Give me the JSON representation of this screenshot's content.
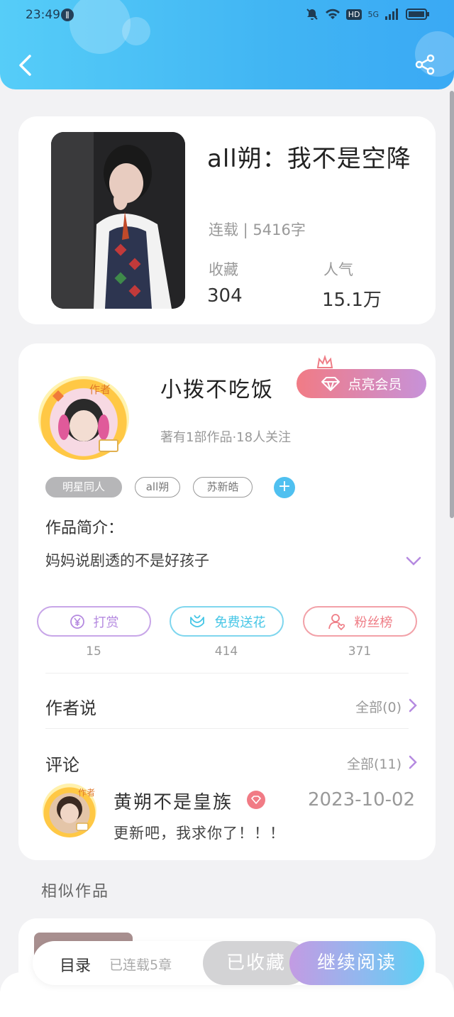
{
  "status_bar": {
    "time": "23:49",
    "notif_icon": "notification-badge-icon",
    "hd": "HD",
    "network": "5G"
  },
  "header": {
    "back_icon": "back-arrow-icon",
    "share_icon": "share-icon"
  },
  "book": {
    "title": "all朔：我不是空降",
    "status": "连载 | 5416字",
    "favorites_label": "收藏",
    "favorites_value": "304",
    "popularity_label": "人气",
    "popularity_value": "15.1万"
  },
  "author": {
    "avatar_tag": "作者",
    "name": "小拨不吃饭",
    "vip_button": "点亮会员",
    "meta": "著有1部作品·18人关注"
  },
  "tags": [
    "明星同人",
    "all朔",
    "苏新皓"
  ],
  "intro": {
    "label": "作品简介：",
    "text": "妈妈说剧透的不是好孩子"
  },
  "actions": [
    {
      "label": "打赏",
      "count": "15",
      "color": "#b58ae0"
    },
    {
      "label": "免费送花",
      "count": "414",
      "color": "#46c6e6"
    },
    {
      "label": "粉丝榜",
      "count": "371",
      "color": "#ef7d86"
    }
  ],
  "author_says": {
    "title": "作者说",
    "more": "全部(0)"
  },
  "comments": {
    "title": "评论",
    "more": "全部(11)",
    "first": {
      "avatar_tag": "作者",
      "user": "黄朔不是皇族",
      "date": "2023-10-02",
      "text": "更新吧，我求你了！！！"
    }
  },
  "similar": {
    "label": "相似作品"
  },
  "bottom_bar": {
    "toc": "目录",
    "toc_status": "已连载5章",
    "favorited": "已收藏",
    "continue": "继续阅读"
  }
}
